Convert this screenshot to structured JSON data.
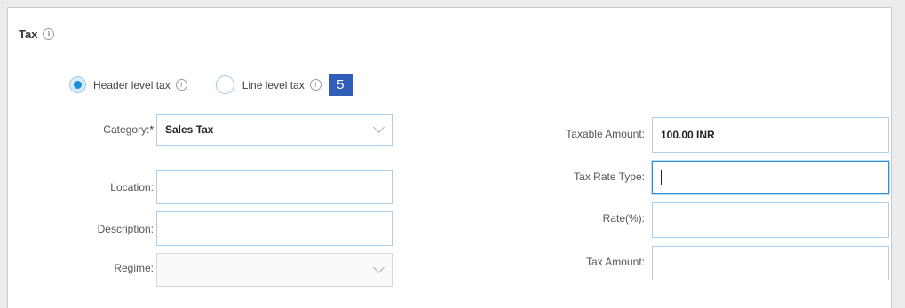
{
  "section": {
    "title": "Tax"
  },
  "tax_level": {
    "options": [
      {
        "label": "Header level tax",
        "selected": true
      },
      {
        "label": "Line level tax",
        "selected": false
      }
    ],
    "step_badge": "5"
  },
  "left_fields": {
    "category": {
      "label": "Category:",
      "required_mark": "*",
      "value": "Sales Tax"
    },
    "location": {
      "label": "Location:",
      "value": ""
    },
    "description": {
      "label": "Description:",
      "value": ""
    },
    "regime": {
      "label": "Regime:",
      "value": ""
    }
  },
  "right_fields": {
    "taxable_amount": {
      "label": "Taxable Amount:",
      "value": "100.00 INR"
    },
    "tax_rate_type": {
      "label": "Tax Rate Type:",
      "value": ""
    },
    "rate": {
      "label": "Rate(%):",
      "value": ""
    },
    "tax_amount": {
      "label": "Tax Amount:",
      "value": ""
    }
  },
  "colors": {
    "accent": "#1a8de0",
    "field_border": "#a9cfef",
    "badge": "#2f5db7"
  }
}
